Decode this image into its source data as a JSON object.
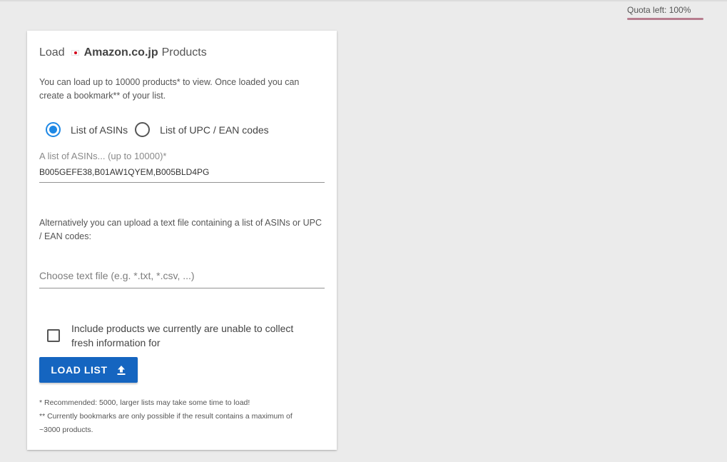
{
  "quota": {
    "text": "Quota left: 100%"
  },
  "card": {
    "title": {
      "prefix": "Load",
      "marketplace": "Amazon.co.jp",
      "suffix": "Products"
    },
    "intro": "You can load up to 10000 products* to view. Once loaded you can create a bookmark** of your list.",
    "radios": [
      {
        "label": "List of ASINs",
        "checked": true
      },
      {
        "label": "List of UPC / EAN codes",
        "checked": false
      }
    ],
    "asin_field": {
      "label": "A list of ASINs... (up to 10000)*",
      "value": "B005GEFE38,B01AW1QYEM,B005BLD4PG"
    },
    "alt_text": "Alternatively you can upload a text file containing a list of ASINs or UPC / EAN codes:",
    "file_input": {
      "placeholder": "Choose text file (e.g. *.txt, *.csv, ...)"
    },
    "include_checkbox": {
      "label": "Include products we currently are unable to collect fresh information for",
      "checked": false
    },
    "load_button": {
      "label": "LOAD LIST"
    },
    "notes": [
      "* Recommended: 5000, larger lists may take some time to load!",
      "** Currently bookmarks are only possible if the result contains a maximum of ~3000 products."
    ]
  },
  "colors": {
    "accent": "#1e88e5",
    "button": "#1565c0",
    "quota_bar": "#b77d8f",
    "flag_red": "#d4001b"
  },
  "icons": {
    "flag": "japan-flag-icon",
    "upload": "upload-icon"
  }
}
